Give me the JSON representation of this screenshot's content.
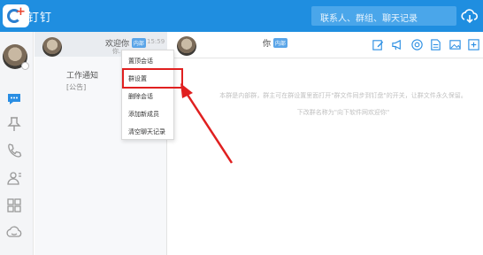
{
  "titlebar": {
    "app_name": "钉钉",
    "search_placeholder": "联系人、群组、聊天记录",
    "bg_color": "#1f8ee0",
    "icons": [
      "dingtalk-logo",
      "cloud-download-icon"
    ]
  },
  "rail": {
    "icons": [
      "chat-bubble-icon",
      "pin-icon",
      "phone-icon",
      "contacts-icon",
      "apps-grid-icon",
      "cloud-icon"
    ]
  },
  "conversations": [
    {
      "name": "欢迎你",
      "tag": "内部",
      "time": "15:59",
      "snippet": "你..."
    },
    {
      "title": "工作通知",
      "subtitle": "[公告]"
    }
  ],
  "chat": {
    "title": "你",
    "tag": "内部",
    "notice_line1": "本群是内部群，群主可在群设置里面打开\"群文件同步到钉盘\"的开关，让群文件永久保留。",
    "notice_line2": "下改群名称为\"向下软件网欢迎你\"",
    "tools": [
      "edit-icon",
      "megaphone-icon",
      "at-icon",
      "file-icon",
      "image-icon",
      "more-icon"
    ]
  },
  "context_menu": {
    "items": [
      {
        "label": "置顶会话"
      },
      {
        "label": "群设置",
        "highlighted": true
      },
      {
        "label": "删除会话"
      },
      {
        "label": "添加新成员"
      },
      {
        "label": "清空聊天记录"
      }
    ],
    "highlight_color": "#e02020"
  }
}
